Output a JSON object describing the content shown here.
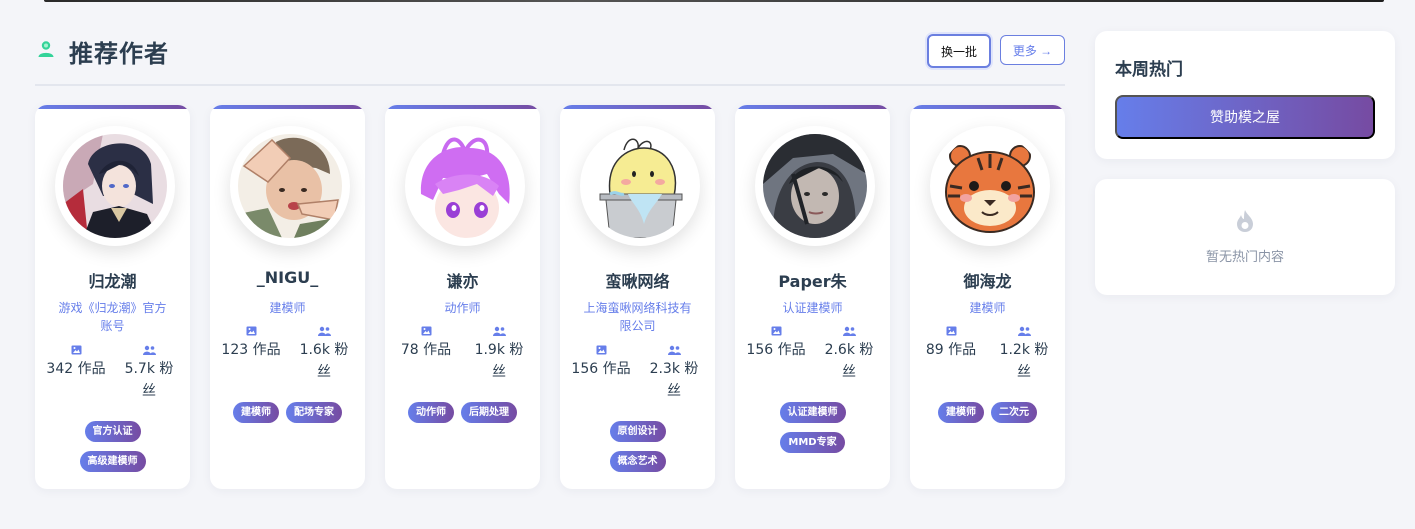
{
  "section": {
    "title": "推荐作者",
    "refresh_label": "换一批",
    "more_label": "更多 →"
  },
  "authors": [
    {
      "name": "归龙潮",
      "desc": "游戏《归龙潮》官方账号",
      "works": "342 作品",
      "fans": "5.7k 粉丝",
      "tags": [
        "官方认证",
        "高级建模师"
      ]
    },
    {
      "name": "_NIGU_",
      "desc": "建模师",
      "works": "123 作品",
      "fans": "1.6k 粉丝",
      "tags": [
        "建模师",
        "配场专家"
      ]
    },
    {
      "name": "谦亦",
      "desc": "动作师",
      "works": "78 作品",
      "fans": "1.9k 粉丝",
      "tags": [
        "动作师",
        "后期处理"
      ]
    },
    {
      "name": "蛮啾网络",
      "desc": "上海蛮啾网络科技有限公司",
      "works": "156 作品",
      "fans": "2.3k 粉丝",
      "tags": [
        "原创设计",
        "概念艺术"
      ]
    },
    {
      "name": "Paper朱",
      "desc": "认证建模师",
      "works": "156 作品",
      "fans": "2.6k 粉丝",
      "tags": [
        "认证建模师",
        "MMD专家"
      ]
    },
    {
      "name": "御海龙",
      "desc": "建模师",
      "works": "89 作品",
      "fans": "1.2k 粉丝",
      "tags": [
        "建模师",
        "二次元"
      ]
    }
  ],
  "sidebar": {
    "hot_title": "本周热门",
    "sponsor_label": "赞助模之屋",
    "empty_text": "暂无热门内容"
  },
  "colors": {
    "accent_start": "#667eea",
    "accent_end": "#764ba2",
    "title_text": "#2c3e50",
    "section_icon": "#34d399"
  },
  "icons": {
    "section": "user-icon",
    "works": "image-icon",
    "fans": "users-icon",
    "empty": "fire-icon"
  }
}
